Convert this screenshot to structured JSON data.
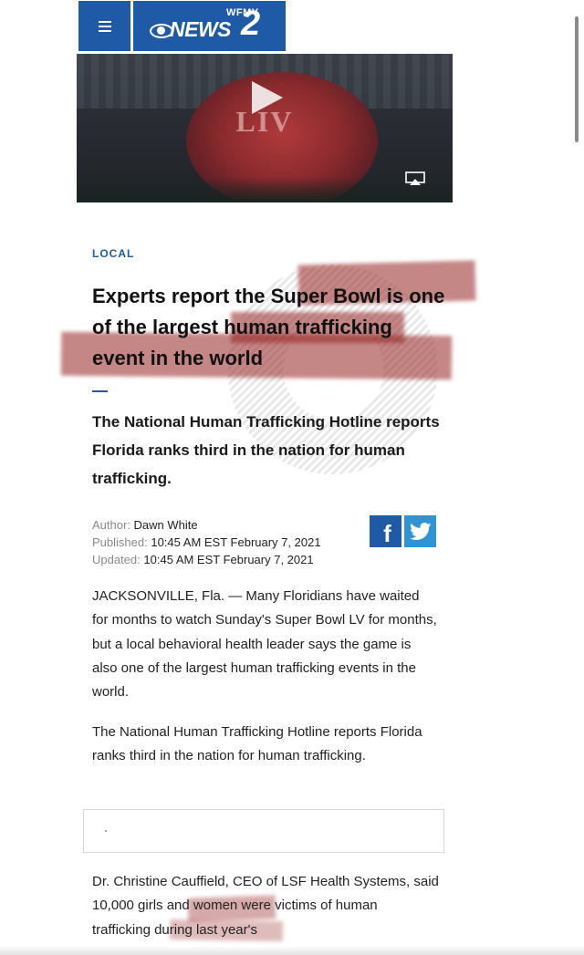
{
  "header": {
    "menu_icon": "hamburger-icon",
    "logo": {
      "call_letters": "WFMY",
      "network_icon": "cbs-eye-icon",
      "brand": "NEWS",
      "channel": "2"
    }
  },
  "video": {
    "play_icon": "play-icon",
    "airplay_icon": "airplay-icon",
    "overlay_text": "LIV"
  },
  "article": {
    "section": "LOCAL",
    "headline": "Experts report the Super Bowl is one of the largest human trafficking event in the world",
    "subheadline": "The National Human Trafficking Hotline reports Florida ranks third in the nation for human trafficking.",
    "meta": {
      "author_label": "Author:",
      "author": "Dawn White",
      "published_label": "Published:",
      "published": "10:45 AM EST February 7, 2021",
      "updated_label": "Updated:",
      "updated": "10:45 AM EST February 7, 2021"
    },
    "share": {
      "facebook_glyph": "f",
      "facebook_icon": "facebook-icon",
      "twitter_icon": "twitter-icon"
    },
    "paragraphs": [
      "JACKSONVILLE, Fla. — Many Floridians have waited for months to watch Sunday's Super Bowl LV for months, but a local behavioral health leader says the game is also one of the largest human trafficking events in the world.",
      "The National Human Trafficking Hotline reports Florida ranks third in the nation for human trafficking.",
      "Dr. Christine Cauffield, CEO of LSF Health Systems, said 10,000 girls and women were victims of human trafficking during last year's"
    ]
  },
  "colors": {
    "brand_blue": "#1f5aa6",
    "twitter_blue": "#2f93d6",
    "highlight_red": "#962323"
  }
}
